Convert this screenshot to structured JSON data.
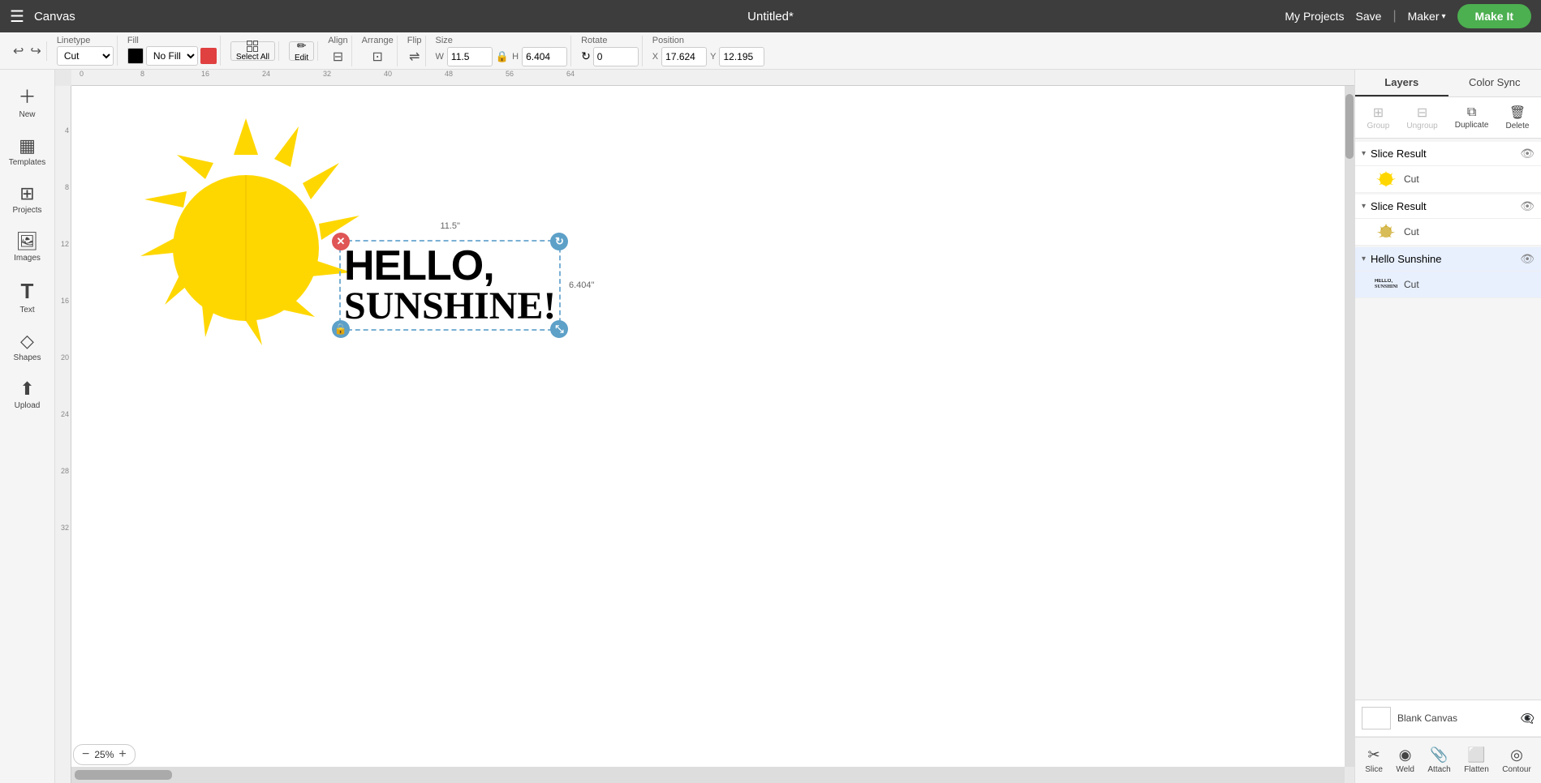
{
  "topbar": {
    "menu_icon": "☰",
    "app_title": "Canvas",
    "doc_title": "Untitled*",
    "my_projects_label": "My Projects",
    "save_label": "Save",
    "divider": "|",
    "maker_label": "Maker",
    "maker_chevron": "▾",
    "make_it_label": "Make It"
  },
  "toolbar": {
    "undo_icon": "↩",
    "redo_icon": "↪",
    "linetype_label": "Linetype",
    "linetype_value": "Cut",
    "fill_label": "Fill",
    "fill_value": "No Fill",
    "select_all_label": "Select All",
    "edit_label": "Edit",
    "align_label": "Align",
    "arrange_label": "Arrange",
    "flip_label": "Flip",
    "size_label": "Size",
    "size_w_label": "W",
    "size_w_value": "11.5",
    "size_h_label": "H",
    "size_h_value": "6.404",
    "lock_icon": "🔒",
    "rotate_label": "Rotate",
    "rotate_value": "0",
    "position_label": "Position",
    "position_x_label": "X",
    "position_x_value": "17.624",
    "position_y_label": "Y",
    "position_y_value": "12.195"
  },
  "sidebar": {
    "items": [
      {
        "id": "new",
        "icon": "＋",
        "label": "New"
      },
      {
        "id": "templates",
        "icon": "▦",
        "label": "Templates"
      },
      {
        "id": "projects",
        "icon": "⊞",
        "label": "Projects"
      },
      {
        "id": "images",
        "icon": "🖼",
        "label": "Images"
      },
      {
        "id": "text",
        "icon": "T",
        "label": "Text"
      },
      {
        "id": "shapes",
        "icon": "◇",
        "label": "Shapes"
      },
      {
        "id": "upload",
        "icon": "⬆",
        "label": "Upload"
      }
    ]
  },
  "canvas": {
    "ruler_marks": [
      "0",
      "8",
      "16",
      "24",
      "32",
      "40",
      "48",
      "56",
      "64"
    ],
    "ruler_left_marks": [
      "4",
      "8",
      "12",
      "16",
      "20",
      "24",
      "28",
      "32"
    ],
    "size_label_top": "11.5\"",
    "size_label_right": "6.404\"",
    "zoom_value": "25%"
  },
  "text_element": {
    "line1": "HELLO,",
    "line2": "SUNSHINE!"
  },
  "right_panel": {
    "tab_layers": "Layers",
    "tab_color_sync": "Color Sync",
    "tool_group": "Group",
    "tool_ungroup": "Ungroup",
    "tool_duplicate": "Duplicate",
    "tool_delete": "Delete",
    "layers": [
      {
        "id": "slice1",
        "title": "Slice Result",
        "expanded": true,
        "visible": true,
        "items": [
          {
            "id": "slice1-item",
            "name": "Cut",
            "thumb_color": "#f5c518",
            "selected": false
          }
        ]
      },
      {
        "id": "slice2",
        "title": "Slice Result",
        "expanded": true,
        "visible": true,
        "items": [
          {
            "id": "slice2-item",
            "name": "Cut",
            "thumb_color": "#c8a010",
            "selected": false
          }
        ]
      },
      {
        "id": "hello",
        "title": "Hello Sunshine",
        "expanded": true,
        "visible": true,
        "items": [
          {
            "id": "hello-item",
            "name": "Cut",
            "thumb_text": "HELLO\nSUNSHINE",
            "selected": true
          }
        ]
      }
    ],
    "blank_canvas_label": "Blank Canvas",
    "bottom_tools": [
      {
        "id": "slice",
        "icon": "✂",
        "label": "Slice"
      },
      {
        "id": "weld",
        "icon": "◉",
        "label": "Weld"
      },
      {
        "id": "attach",
        "icon": "📎",
        "label": "Attach"
      },
      {
        "id": "flatten",
        "icon": "⬜",
        "label": "Flatten"
      },
      {
        "id": "contour",
        "icon": "◎",
        "label": "Contour"
      }
    ]
  }
}
